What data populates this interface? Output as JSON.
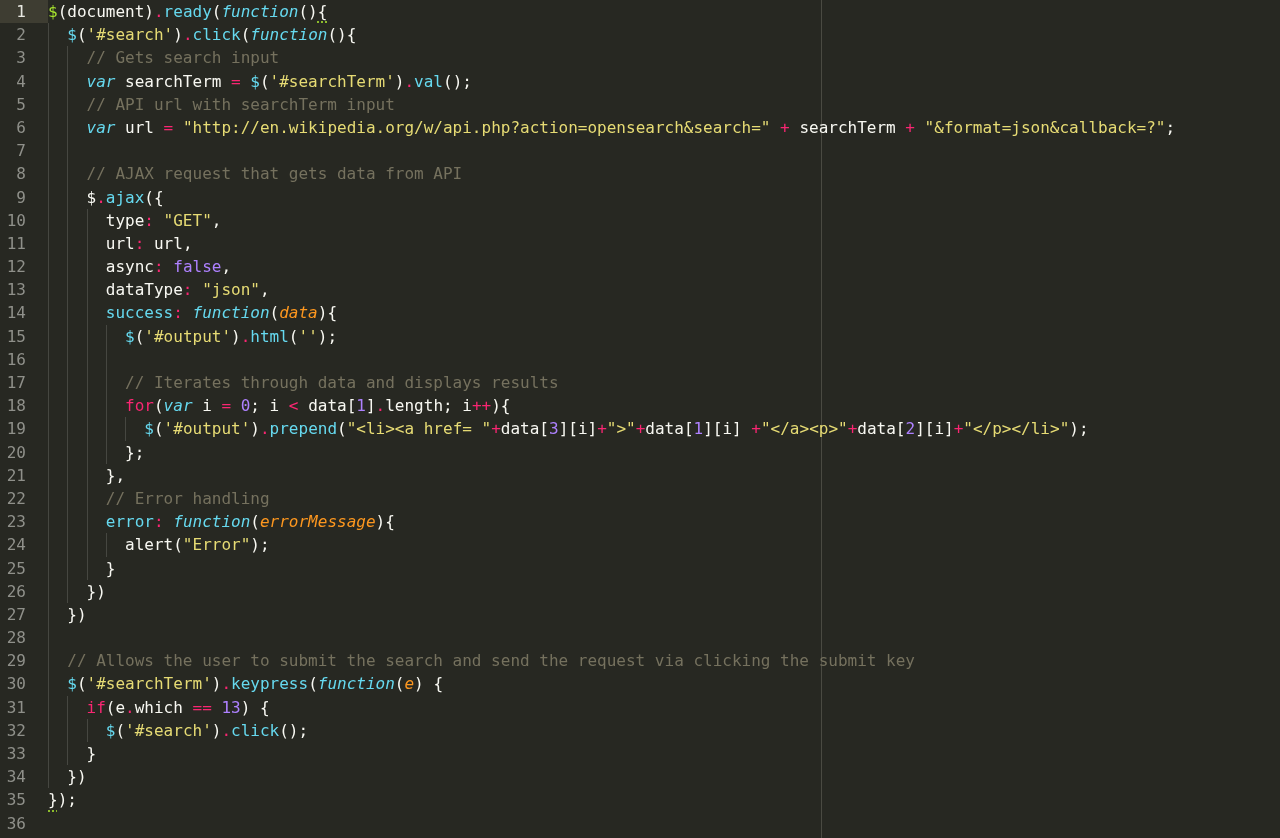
{
  "editor": {
    "ruler": true,
    "lines": [
      {
        "number": "1",
        "current": true,
        "tokens": [
          {
            "kind": "entity",
            "text": "$"
          },
          {
            "kind": "plain",
            "text": "(document)"
          },
          {
            "kind": "keyword",
            "text": "."
          },
          {
            "kind": "support",
            "text": "ready"
          },
          {
            "kind": "plain",
            "text": "("
          },
          {
            "kind": "storage",
            "text": "function"
          },
          {
            "kind": "plain",
            "text": "()"
          },
          {
            "kind": "matched",
            "text": "{"
          }
        ]
      },
      {
        "number": "2",
        "current": false,
        "tokens": [
          {
            "kind": "support",
            "text": "  $"
          },
          {
            "kind": "plain",
            "text": "("
          },
          {
            "kind": "string",
            "text": "'#search'"
          },
          {
            "kind": "plain",
            "text": ")"
          },
          {
            "kind": "keyword",
            "text": "."
          },
          {
            "kind": "support",
            "text": "click"
          },
          {
            "kind": "plain",
            "text": "("
          },
          {
            "kind": "storage",
            "text": "function"
          },
          {
            "kind": "plain",
            "text": "(){"
          }
        ]
      },
      {
        "number": "3",
        "current": false,
        "tokens": [
          {
            "kind": "comment",
            "text": "    // Gets search input"
          }
        ]
      },
      {
        "number": "4",
        "current": false,
        "tokens": [
          {
            "kind": "storage",
            "text": "    var"
          },
          {
            "kind": "plain",
            "text": " searchTerm "
          },
          {
            "kind": "keyword",
            "text": "="
          },
          {
            "kind": "support",
            "text": " $"
          },
          {
            "kind": "plain",
            "text": "("
          },
          {
            "kind": "string",
            "text": "'#searchTerm'"
          },
          {
            "kind": "plain",
            "text": ")"
          },
          {
            "kind": "keyword",
            "text": "."
          },
          {
            "kind": "support",
            "text": "val"
          },
          {
            "kind": "plain",
            "text": "();"
          }
        ]
      },
      {
        "number": "5",
        "current": false,
        "tokens": [
          {
            "kind": "comment",
            "text": "    // API url with searchTerm input"
          }
        ]
      },
      {
        "number": "6",
        "current": false,
        "tokens": [
          {
            "kind": "storage",
            "text": "    var"
          },
          {
            "kind": "plain",
            "text": " url "
          },
          {
            "kind": "keyword",
            "text": "="
          },
          {
            "kind": "string",
            "text": " \"http://en.wikipedia.org/w/api.php?action=opensearch&search=\""
          },
          {
            "kind": "keyword",
            "text": " +"
          },
          {
            "kind": "plain",
            "text": " searchTerm "
          },
          {
            "kind": "keyword",
            "text": "+"
          },
          {
            "kind": "string",
            "text": " \"&format=json&callback=?\""
          },
          {
            "kind": "plain",
            "text": ";"
          }
        ]
      },
      {
        "number": "7",
        "current": false
      },
      {
        "number": "8",
        "current": false,
        "tokens": [
          {
            "kind": "comment",
            "text": "    // AJAX request that gets data from API"
          }
        ]
      },
      {
        "number": "9",
        "current": false,
        "tokens": [
          {
            "kind": "plain",
            "text": "    $"
          },
          {
            "kind": "keyword",
            "text": "."
          },
          {
            "kind": "support",
            "text": "ajax"
          },
          {
            "kind": "plain",
            "text": "({"
          }
        ]
      },
      {
        "number": "10",
        "current": false,
        "tokens": [
          {
            "kind": "plain",
            "text": "      type"
          },
          {
            "kind": "keyword",
            "text": ":"
          },
          {
            "kind": "string",
            "text": " \"GET\""
          },
          {
            "kind": "plain",
            "text": ","
          }
        ]
      },
      {
        "number": "11",
        "current": false,
        "tokens": [
          {
            "kind": "plain",
            "text": "      url"
          },
          {
            "kind": "keyword",
            "text": ":"
          },
          {
            "kind": "plain",
            "text": " url,"
          }
        ]
      },
      {
        "number": "12",
        "current": false,
        "tokens": [
          {
            "kind": "plain",
            "text": "      async"
          },
          {
            "kind": "keyword",
            "text": ":"
          },
          {
            "kind": "number",
            "text": " false"
          },
          {
            "kind": "plain",
            "text": ","
          }
        ]
      },
      {
        "number": "13",
        "current": false,
        "tokens": [
          {
            "kind": "plain",
            "text": "      dataType"
          },
          {
            "kind": "keyword",
            "text": ":"
          },
          {
            "kind": "string",
            "text": " \"json\""
          },
          {
            "kind": "plain",
            "text": ","
          }
        ]
      },
      {
        "number": "14",
        "current": false,
        "tokens": [
          {
            "kind": "support",
            "text": "      success"
          },
          {
            "kind": "keyword",
            "text": ":"
          },
          {
            "kind": "storage",
            "text": " function"
          },
          {
            "kind": "plain",
            "text": "("
          },
          {
            "kind": "param",
            "text": "data"
          },
          {
            "kind": "plain",
            "text": "){"
          }
        ]
      },
      {
        "number": "15",
        "current": false,
        "tokens": [
          {
            "kind": "support",
            "text": "        $"
          },
          {
            "kind": "plain",
            "text": "("
          },
          {
            "kind": "string",
            "text": "'#output'"
          },
          {
            "kind": "plain",
            "text": ")"
          },
          {
            "kind": "keyword",
            "text": "."
          },
          {
            "kind": "support",
            "text": "html"
          },
          {
            "kind": "plain",
            "text": "("
          },
          {
            "kind": "string",
            "text": "''"
          },
          {
            "kind": "plain",
            "text": ");"
          }
        ]
      },
      {
        "number": "16",
        "current": false
      },
      {
        "number": "17",
        "current": false,
        "tokens": [
          {
            "kind": "comment",
            "text": "        // Iterates through data and displays results"
          }
        ]
      },
      {
        "number": "18",
        "current": false,
        "tokens": [
          {
            "kind": "keyword",
            "text": "        for"
          },
          {
            "kind": "plain",
            "text": "("
          },
          {
            "kind": "storage",
            "text": "var"
          },
          {
            "kind": "plain",
            "text": " i "
          },
          {
            "kind": "keyword",
            "text": "="
          },
          {
            "kind": "number",
            "text": " 0"
          },
          {
            "kind": "plain",
            "text": "; i "
          },
          {
            "kind": "keyword",
            "text": "<"
          },
          {
            "kind": "plain",
            "text": " data["
          },
          {
            "kind": "number",
            "text": "1"
          },
          {
            "kind": "plain",
            "text": "]"
          },
          {
            "kind": "keyword",
            "text": "."
          },
          {
            "kind": "plain",
            "text": "length; i"
          },
          {
            "kind": "keyword",
            "text": "++"
          },
          {
            "kind": "plain",
            "text": "){"
          }
        ]
      },
      {
        "number": "19",
        "current": false,
        "tokens": [
          {
            "kind": "support",
            "text": "          $"
          },
          {
            "kind": "plain",
            "text": "("
          },
          {
            "kind": "string",
            "text": "'#output'"
          },
          {
            "kind": "plain",
            "text": ")"
          },
          {
            "kind": "keyword",
            "text": "."
          },
          {
            "kind": "support",
            "text": "prepend"
          },
          {
            "kind": "plain",
            "text": "("
          },
          {
            "kind": "string",
            "text": "\"<li><a href= \""
          },
          {
            "kind": "keyword",
            "text": "+"
          },
          {
            "kind": "plain",
            "text": "data["
          },
          {
            "kind": "number",
            "text": "3"
          },
          {
            "kind": "plain",
            "text": "][i]"
          },
          {
            "kind": "keyword",
            "text": "+"
          },
          {
            "kind": "string",
            "text": "\">\""
          },
          {
            "kind": "keyword",
            "text": "+"
          },
          {
            "kind": "plain",
            "text": "data["
          },
          {
            "kind": "number",
            "text": "1"
          },
          {
            "kind": "plain",
            "text": "][i] "
          },
          {
            "kind": "keyword",
            "text": "+"
          },
          {
            "kind": "string",
            "text": "\"</a><p>\""
          },
          {
            "kind": "keyword",
            "text": "+"
          },
          {
            "kind": "plain",
            "text": "data["
          },
          {
            "kind": "number",
            "text": "2"
          },
          {
            "kind": "plain",
            "text": "][i]"
          },
          {
            "kind": "keyword",
            "text": "+"
          },
          {
            "kind": "string",
            "text": "\"</p></li>\""
          },
          {
            "kind": "plain",
            "text": ");"
          }
        ]
      },
      {
        "number": "20",
        "current": false,
        "tokens": [
          {
            "kind": "plain",
            "text": "        };"
          }
        ]
      },
      {
        "number": "21",
        "current": false,
        "tokens": [
          {
            "kind": "plain",
            "text": "      },"
          }
        ]
      },
      {
        "number": "22",
        "current": false,
        "tokens": [
          {
            "kind": "comment",
            "text": "      // Error handling"
          }
        ]
      },
      {
        "number": "23",
        "current": false,
        "tokens": [
          {
            "kind": "support",
            "text": "      error"
          },
          {
            "kind": "keyword",
            "text": ":"
          },
          {
            "kind": "storage",
            "text": " function"
          },
          {
            "kind": "plain",
            "text": "("
          },
          {
            "kind": "param",
            "text": "errorMessage"
          },
          {
            "kind": "plain",
            "text": "){"
          }
        ]
      },
      {
        "number": "24",
        "current": false,
        "tokens": [
          {
            "kind": "plain",
            "text": "        alert("
          },
          {
            "kind": "string",
            "text": "\"Error\""
          },
          {
            "kind": "plain",
            "text": ");"
          }
        ]
      },
      {
        "number": "25",
        "current": false,
        "tokens": [
          {
            "kind": "plain",
            "text": "      }"
          }
        ]
      },
      {
        "number": "26",
        "current": false,
        "tokens": [
          {
            "kind": "plain",
            "text": "    })"
          }
        ]
      },
      {
        "number": "27",
        "current": false,
        "tokens": [
          {
            "kind": "plain",
            "text": "  })"
          }
        ]
      },
      {
        "number": "28",
        "current": false
      },
      {
        "number": "29",
        "current": false,
        "tokens": [
          {
            "kind": "comment",
            "text": "  // Allows the user to submit the search and send the request via clicking the submit key"
          }
        ]
      },
      {
        "number": "30",
        "current": false,
        "tokens": [
          {
            "kind": "support",
            "text": "  $"
          },
          {
            "kind": "plain",
            "text": "("
          },
          {
            "kind": "string",
            "text": "'#searchTerm'"
          },
          {
            "kind": "plain",
            "text": ")"
          },
          {
            "kind": "keyword",
            "text": "."
          },
          {
            "kind": "support",
            "text": "keypress"
          },
          {
            "kind": "plain",
            "text": "("
          },
          {
            "kind": "storage",
            "text": "function"
          },
          {
            "kind": "plain",
            "text": "("
          },
          {
            "kind": "param",
            "text": "e"
          },
          {
            "kind": "plain",
            "text": ") {"
          }
        ]
      },
      {
        "number": "31",
        "current": false,
        "tokens": [
          {
            "kind": "keyword",
            "text": "    if"
          },
          {
            "kind": "plain",
            "text": "(e"
          },
          {
            "kind": "keyword",
            "text": "."
          },
          {
            "kind": "plain",
            "text": "which "
          },
          {
            "kind": "keyword",
            "text": "=="
          },
          {
            "kind": "number",
            "text": " 13"
          },
          {
            "kind": "plain",
            "text": ") {"
          }
        ]
      },
      {
        "number": "32",
        "current": false,
        "tokens": [
          {
            "kind": "support",
            "text": "      $"
          },
          {
            "kind": "plain",
            "text": "("
          },
          {
            "kind": "string",
            "text": "'#search'"
          },
          {
            "kind": "plain",
            "text": ")"
          },
          {
            "kind": "keyword",
            "text": "."
          },
          {
            "kind": "support",
            "text": "click"
          },
          {
            "kind": "plain",
            "text": "();"
          }
        ]
      },
      {
        "number": "33",
        "current": false,
        "tokens": [
          {
            "kind": "plain",
            "text": "    }"
          }
        ]
      },
      {
        "number": "34",
        "current": false,
        "tokens": [
          {
            "kind": "plain",
            "text": "  })"
          }
        ]
      },
      {
        "number": "35",
        "current": false,
        "tokens": [
          {
            "kind": "matched",
            "text": "}"
          },
          {
            "kind": "plain",
            "text": ");"
          }
        ]
      },
      {
        "number": "36",
        "current": false
      }
    ]
  }
}
